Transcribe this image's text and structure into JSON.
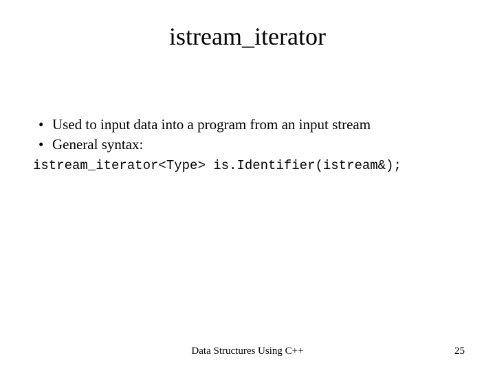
{
  "title": "istream_iterator",
  "bullets": [
    "Used to input data into a program from an input stream",
    "General syntax:"
  ],
  "code": "istream_iterator<Type> is.Identifier(istream&);",
  "footer": {
    "center": "Data Structures Using C++",
    "page": "25"
  }
}
